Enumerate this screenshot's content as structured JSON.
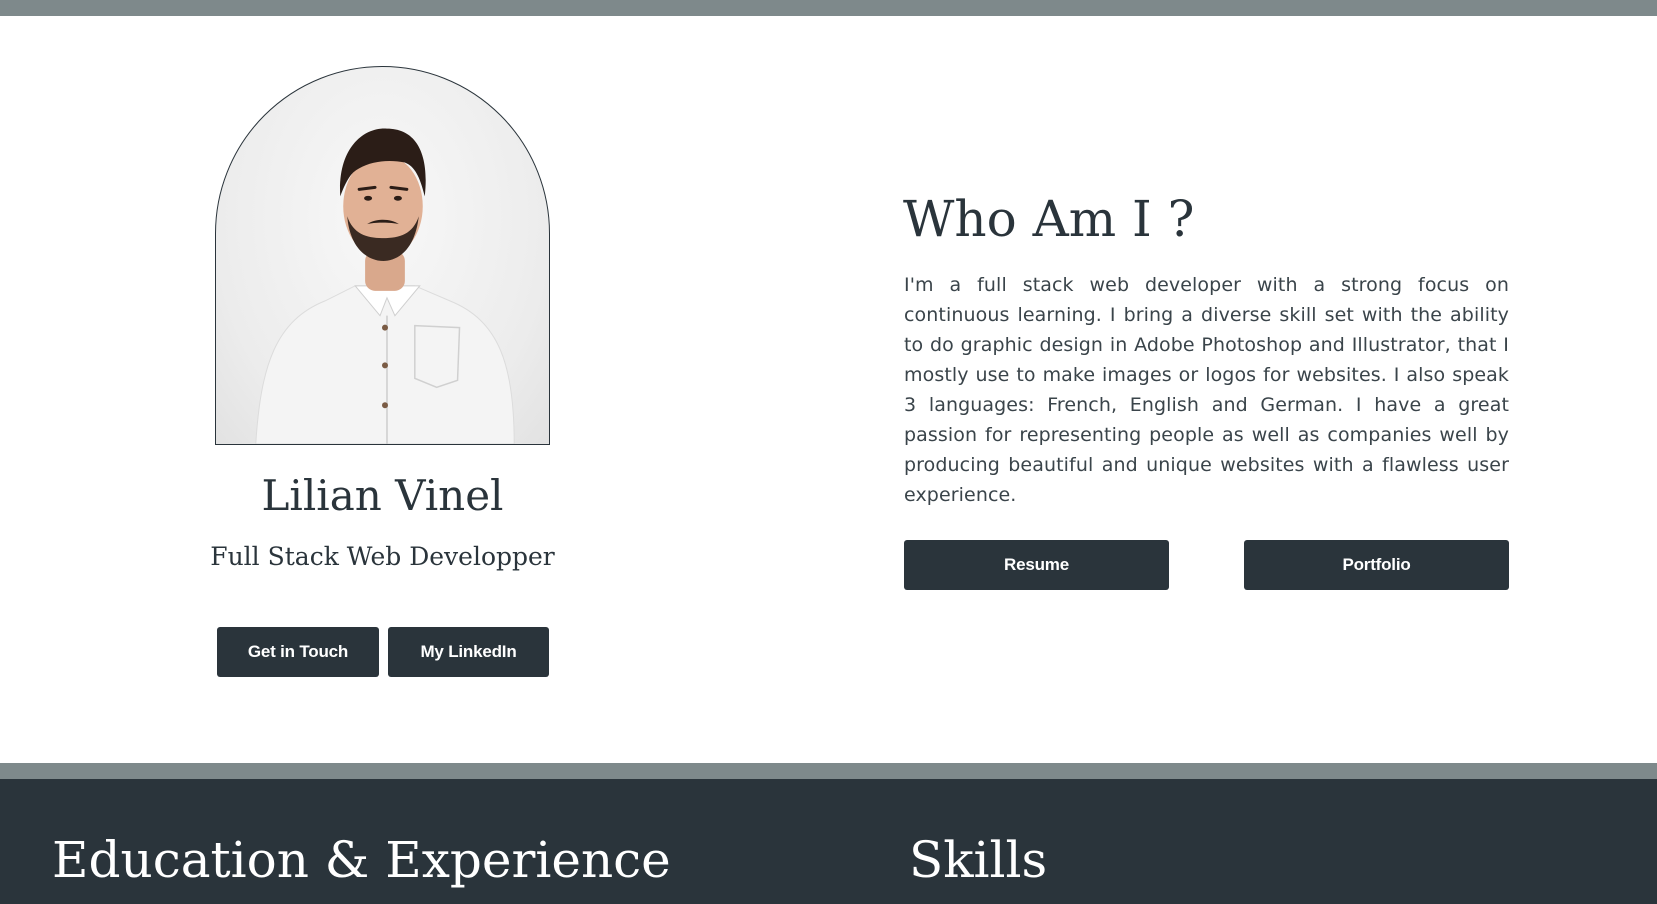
{
  "profile": {
    "name": "Lilian Vinel",
    "role": "Full Stack Web Developper",
    "buttons": {
      "get_in_touch": "Get in Touch",
      "linkedin": "My LinkedIn"
    }
  },
  "about": {
    "title": "Who Am I ?",
    "bio": "I'm a full stack web developer with a strong focus on continuous learning. I bring a diverse skill set with the ability to do graphic design in Adobe Photoshop and Illustrator, that I mostly use to make images or logos for websites. I also speak 3 languages: French, English and German. I have a great passion for representing people as well as companies well by producing beautiful and unique websites with a flawless user experience.",
    "buttons": {
      "resume": "Resume",
      "portfolio": "Portfolio"
    }
  },
  "sections": {
    "education_title": "Education & Experience",
    "skills_title": "Skills"
  },
  "colors": {
    "dark": "#2a343b",
    "bar": "#7e898b",
    "background": "#ffffff"
  }
}
